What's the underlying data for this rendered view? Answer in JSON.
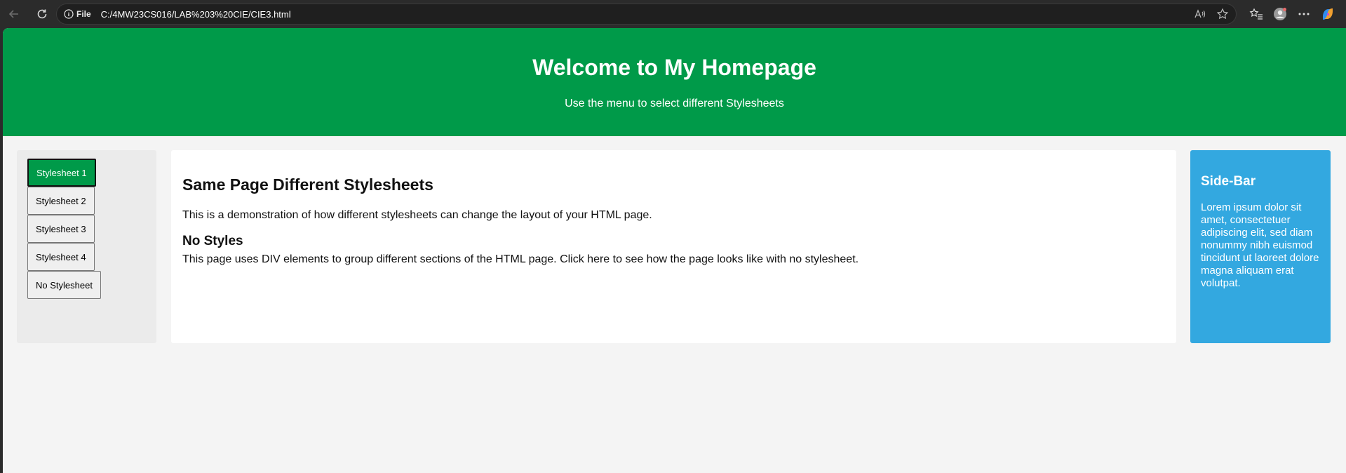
{
  "browser": {
    "address_label": "File",
    "url": "C:/4MW23CS016/LAB%203%20CIE/CIE3.html"
  },
  "header": {
    "title": "Welcome to My Homepage",
    "subtitle": "Use the menu to select different Stylesheets"
  },
  "menu": {
    "items": [
      {
        "label": "Stylesheet 1",
        "active": true
      },
      {
        "label": "Stylesheet 2",
        "active": false
      },
      {
        "label": "Stylesheet 3",
        "active": false
      },
      {
        "label": "Stylesheet 4",
        "active": false
      },
      {
        "label": "No Stylesheet",
        "active": false
      }
    ]
  },
  "main": {
    "heading": "Same Page Different Stylesheets",
    "intro": "This is a demonstration of how different stylesheets can change the layout of your HTML page.",
    "subheading": "No Styles",
    "body": "This page uses DIV elements to group different sections of the HTML page. Click here to see how the page looks like with no stylesheet."
  },
  "sidebar": {
    "title": "Side-Bar",
    "text": "Lorem ipsum dolor sit amet, consectetuer adipiscing elit, sed diam nonummy nibh euismod tincidunt ut laoreet dolore magna aliquam erat volutpat."
  },
  "colors": {
    "header_green": "#009a49",
    "sidebar_blue": "#33a8e0",
    "page_bg": "#f4f4f4"
  }
}
